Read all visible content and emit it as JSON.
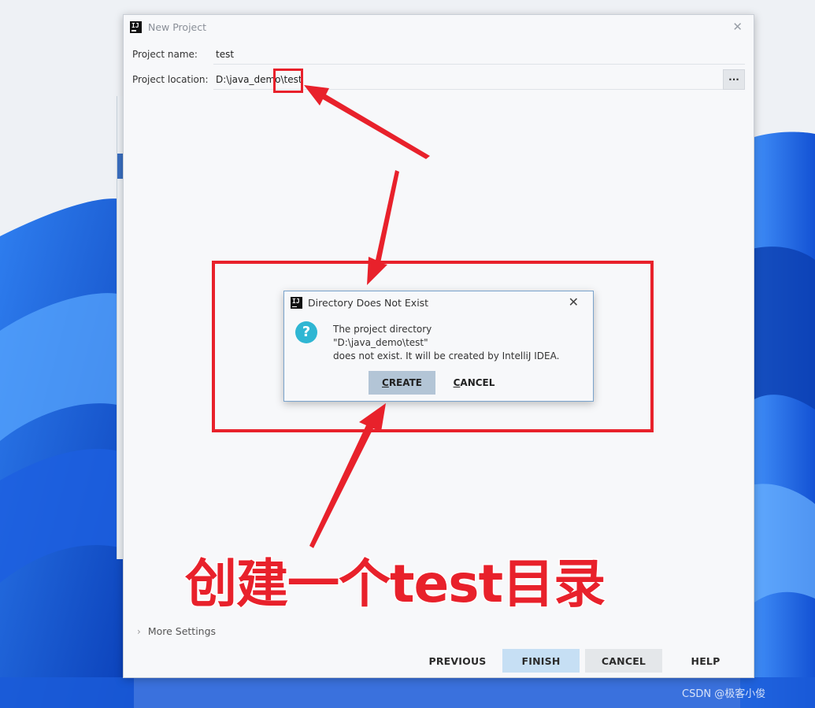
{
  "new_project": {
    "title": "New Project",
    "close_glyph": "✕",
    "project_name_label": "Project name:",
    "project_name_value": "test",
    "project_location_label": "Project location:",
    "project_location_value": "D:\\java_demo\\test",
    "browse_label": "...",
    "more_settings_label": "More Settings",
    "buttons": {
      "previous": "PREVIOUS",
      "finish": "FINISH",
      "cancel": "CANCEL",
      "help": "HELP"
    }
  },
  "directory_dialog": {
    "title": "Directory Does Not Exist",
    "close_glyph": "✕",
    "icon": "question-icon",
    "message_line1": "The project directory",
    "message_line2": "\"D:\\java_demo\\test\"",
    "message_line3": "does not exist. It will be created by IntelliJ IDEA.",
    "create_button": "CREATE",
    "cancel_button": "CANCEL"
  },
  "annotation": {
    "caption": "创建一个test目录",
    "color": "#e8212b"
  },
  "watermark": "CSDN @极客小俊",
  "colors": {
    "accent_blue": "#1f6fe0",
    "finish_bg": "#c6dff4",
    "create_bg": "#b3c5d6"
  }
}
